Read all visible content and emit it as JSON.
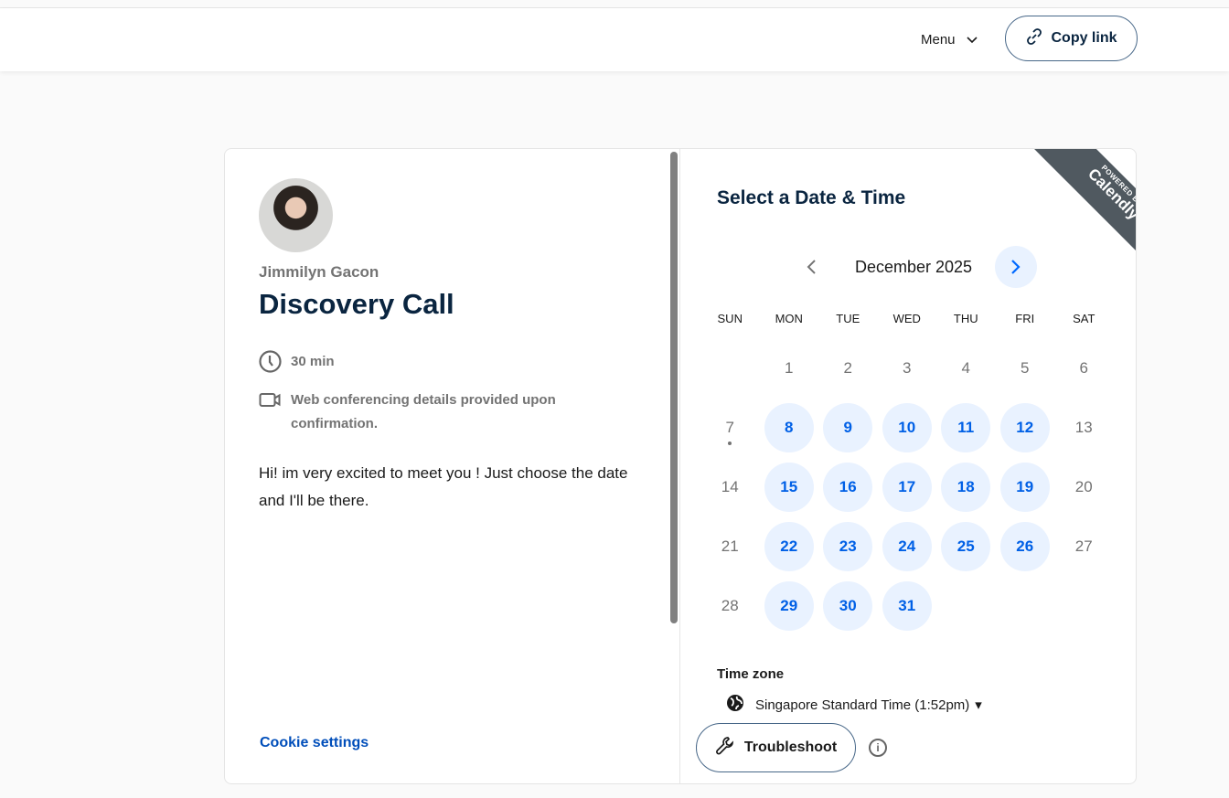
{
  "header": {
    "menu_label": "Menu",
    "copy_link_label": "Copy link"
  },
  "event": {
    "owner": "Jimmilyn Gacon",
    "title": "Discovery Call",
    "duration": "30 min",
    "location": "Web conferencing details provided upon confirmation.",
    "description": "Hi! im very excited to meet you ! Just choose the date and I'll be there.",
    "cookie_settings": "Cookie settings"
  },
  "scheduler": {
    "heading": "Select a Date & Time",
    "powered_by": "POWERED BY",
    "brand": "Calendly",
    "month": "December 2025",
    "weekdays": [
      "SUN",
      "MON",
      "TUE",
      "WED",
      "THU",
      "FRI",
      "SAT"
    ],
    "weeks": [
      [
        null,
        {
          "d": "1"
        },
        {
          "d": "2"
        },
        {
          "d": "3"
        },
        {
          "d": "4"
        },
        {
          "d": "5"
        },
        {
          "d": "6"
        }
      ],
      [
        {
          "d": "7",
          "today": true
        },
        {
          "d": "8",
          "av": true
        },
        {
          "d": "9",
          "av": true
        },
        {
          "d": "10",
          "av": true
        },
        {
          "d": "11",
          "av": true
        },
        {
          "d": "12",
          "av": true
        },
        {
          "d": "13"
        }
      ],
      [
        {
          "d": "14"
        },
        {
          "d": "15",
          "av": true
        },
        {
          "d": "16",
          "av": true
        },
        {
          "d": "17",
          "av": true
        },
        {
          "d": "18",
          "av": true
        },
        {
          "d": "19",
          "av": true
        },
        {
          "d": "20"
        }
      ],
      [
        {
          "d": "21"
        },
        {
          "d": "22",
          "av": true
        },
        {
          "d": "23",
          "av": true
        },
        {
          "d": "24",
          "av": true
        },
        {
          "d": "25",
          "av": true
        },
        {
          "d": "26",
          "av": true
        },
        {
          "d": "27"
        }
      ],
      [
        {
          "d": "28"
        },
        {
          "d": "29",
          "av": true
        },
        {
          "d": "30",
          "av": true
        },
        {
          "d": "31",
          "av": true
        },
        null,
        null,
        null
      ]
    ],
    "timezone_label": "Time zone",
    "timezone": "Singapore Standard Time (1:52pm)",
    "troubleshoot": "Troubleshoot"
  }
}
